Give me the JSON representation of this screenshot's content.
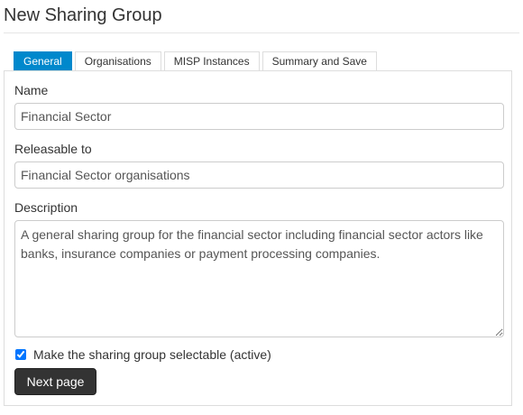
{
  "page": {
    "title": "New Sharing Group"
  },
  "tabs": [
    {
      "label": "General",
      "active": true
    },
    {
      "label": "Organisations",
      "active": false
    },
    {
      "label": "MISP Instances",
      "active": false
    },
    {
      "label": "Summary and Save",
      "active": false
    }
  ],
  "form": {
    "name": {
      "label": "Name",
      "value": "Financial Sector"
    },
    "releasable": {
      "label": "Releasable to",
      "value": "Financial Sector organisations"
    },
    "description": {
      "label": "Description",
      "value": "A general sharing group for the financial sector including financial sector actors like banks, insurance companies or payment processing companies."
    },
    "active_checkbox": {
      "label": "Make the sharing group selectable (active)",
      "checked": true
    },
    "next_button_label": "Next page"
  },
  "colors": {
    "accent": "#0088cc",
    "button_dark": "#333333"
  }
}
